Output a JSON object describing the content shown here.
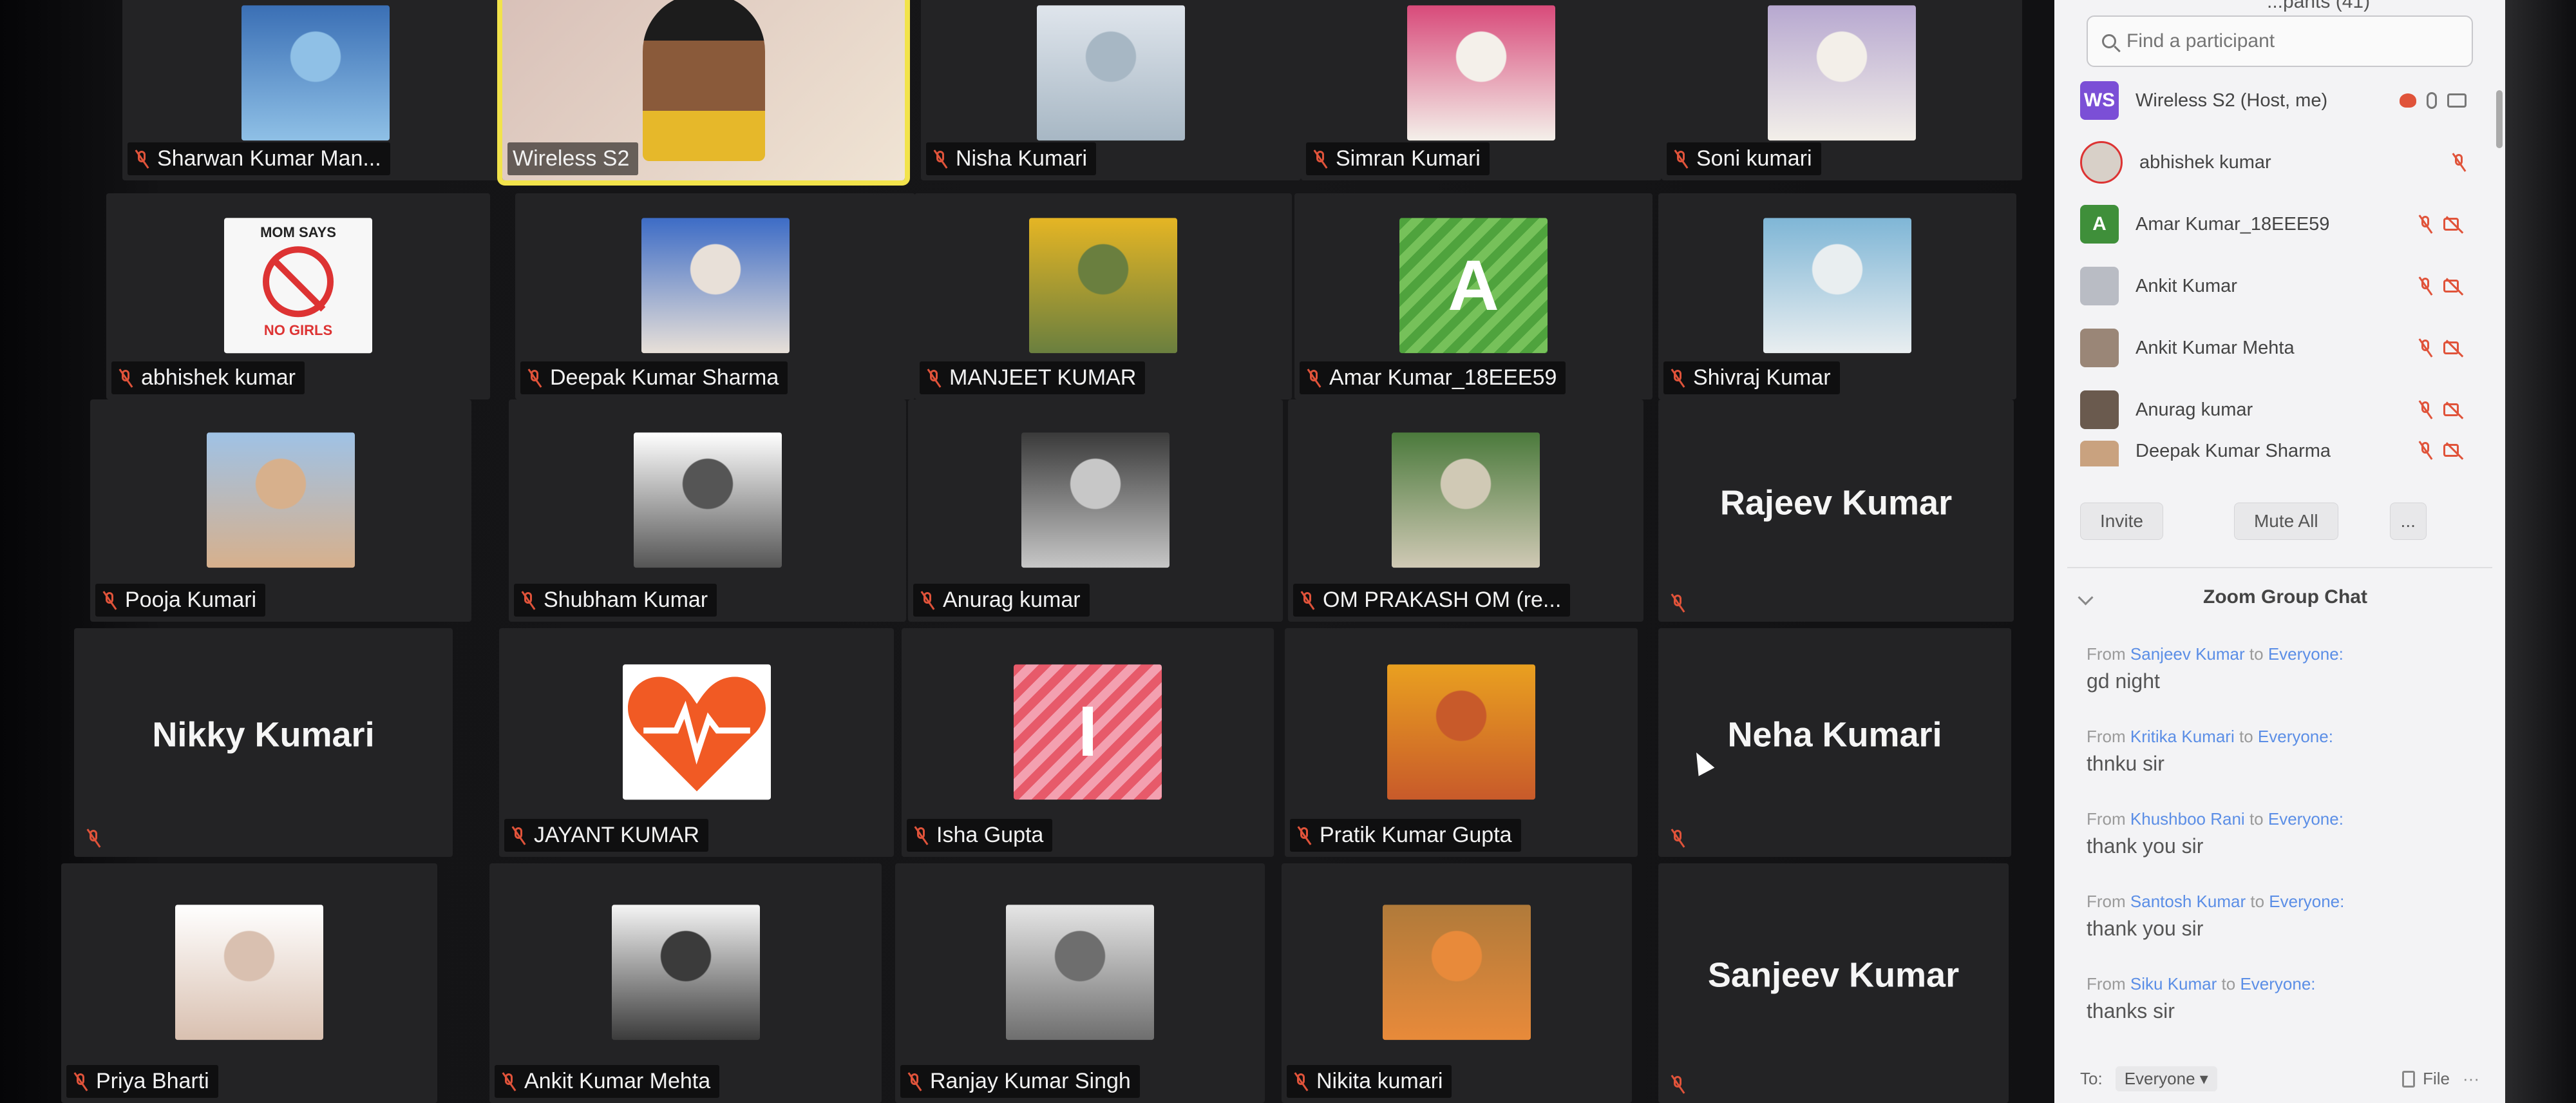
{
  "gallery": {
    "tiles": [
      {
        "name": "Sharwan Kumar Man...",
        "muted": true
      },
      {
        "name": "Wireless S2",
        "muted": false,
        "active": true
      },
      {
        "name": "Nisha Kumari",
        "muted": true
      },
      {
        "name": "Simran Kumari",
        "muted": true
      },
      {
        "name": "Soni kumari",
        "muted": true
      },
      {
        "name": "abhishek kumar",
        "muted": true
      },
      {
        "name": "Deepak Kumar Sharma",
        "muted": true
      },
      {
        "name": "MANJEET KUMAR",
        "muted": true
      },
      {
        "name": "Amar Kumar_18EEE59",
        "muted": true,
        "avatar_letter": "A"
      },
      {
        "name": "Shivraj Kumar",
        "muted": true
      },
      {
        "name": "Pooja Kumari",
        "muted": true
      },
      {
        "name": "Shubham Kumar",
        "muted": true
      },
      {
        "name": "Anurag kumar",
        "muted": true
      },
      {
        "name": "OM PRAKASH OM (re...",
        "muted": true
      },
      {
        "name": "Rajeev Kumar",
        "muted": true,
        "no_video": true
      },
      {
        "name": "Nikky Kumari",
        "muted": true,
        "no_video": true
      },
      {
        "name": "JAYANT KUMAR",
        "muted": true
      },
      {
        "name": "Isha Gupta",
        "muted": true,
        "avatar_letter": "I"
      },
      {
        "name": "Pratik Kumar Gupta",
        "muted": true
      },
      {
        "name": "Neha Kumari",
        "muted": true,
        "no_video": true
      },
      {
        "name": "Priya Bharti",
        "muted": true
      },
      {
        "name": "Ankit Kumar Mehta",
        "muted": true
      },
      {
        "name": "Ranjay Kumar Singh",
        "muted": true
      },
      {
        "name": "Nikita kumari",
        "muted": true
      },
      {
        "name": "Sanjeev Kumar",
        "muted": true,
        "no_video": true
      }
    ],
    "poster_lines": [
      "MOM SAYS",
      "NO GIRLS"
    ]
  },
  "panel": {
    "title": "...pants (41)",
    "search_placeholder": "Find a participant",
    "participants": [
      {
        "initials": "WS",
        "name": "Wireless S2 (Host, me)",
        "avatar_color": "#7b4fd6",
        "host": true
      },
      {
        "initials": "",
        "name": "abhishek kumar",
        "avatar_color": "#d8d0c8"
      },
      {
        "initials": "A",
        "name": "Amar Kumar_18EEE59",
        "avatar_color": "#3f8f3a"
      },
      {
        "initials": "",
        "name": "Ankit Kumar",
        "avatar_color": "#b9bcc4"
      },
      {
        "initials": "",
        "name": "Ankit Kumar Mehta",
        "avatar_color": "#9a8677"
      },
      {
        "initials": "",
        "name": "Anurag kumar",
        "avatar_color": "#6a5a4e"
      },
      {
        "initials": "",
        "name": "Deepak Kumar Sharma",
        "avatar_color": "#c9a27f"
      }
    ],
    "buttons": {
      "invite": "Invite",
      "mute_all": "Mute All",
      "more": "..."
    },
    "chat": {
      "title": "Zoom Group Chat",
      "from_label": "From",
      "to_label": "to",
      "messages": [
        {
          "from": "Sanjeev Kumar",
          "to": "Everyone:",
          "text": "gd night"
        },
        {
          "from": "Kritika Kumari",
          "to": "Everyone:",
          "text": "thnku sir"
        },
        {
          "from": "Khushboo Rani",
          "to": "Everyone:",
          "text": "thank you sir"
        },
        {
          "from": "Santosh Kumar",
          "to": "Everyone:",
          "text": "thank you sir"
        },
        {
          "from": "Siku Kumar",
          "to": "Everyone:",
          "text": "thanks sir"
        }
      ],
      "footer": {
        "to": "To:",
        "recipient": "Everyone ▾",
        "file": "File",
        "more": "···"
      }
    }
  },
  "colors": {
    "muted_icon": "#e0533a",
    "active_border": "#f2e34b",
    "chat_blue": "#5b8ee6"
  }
}
